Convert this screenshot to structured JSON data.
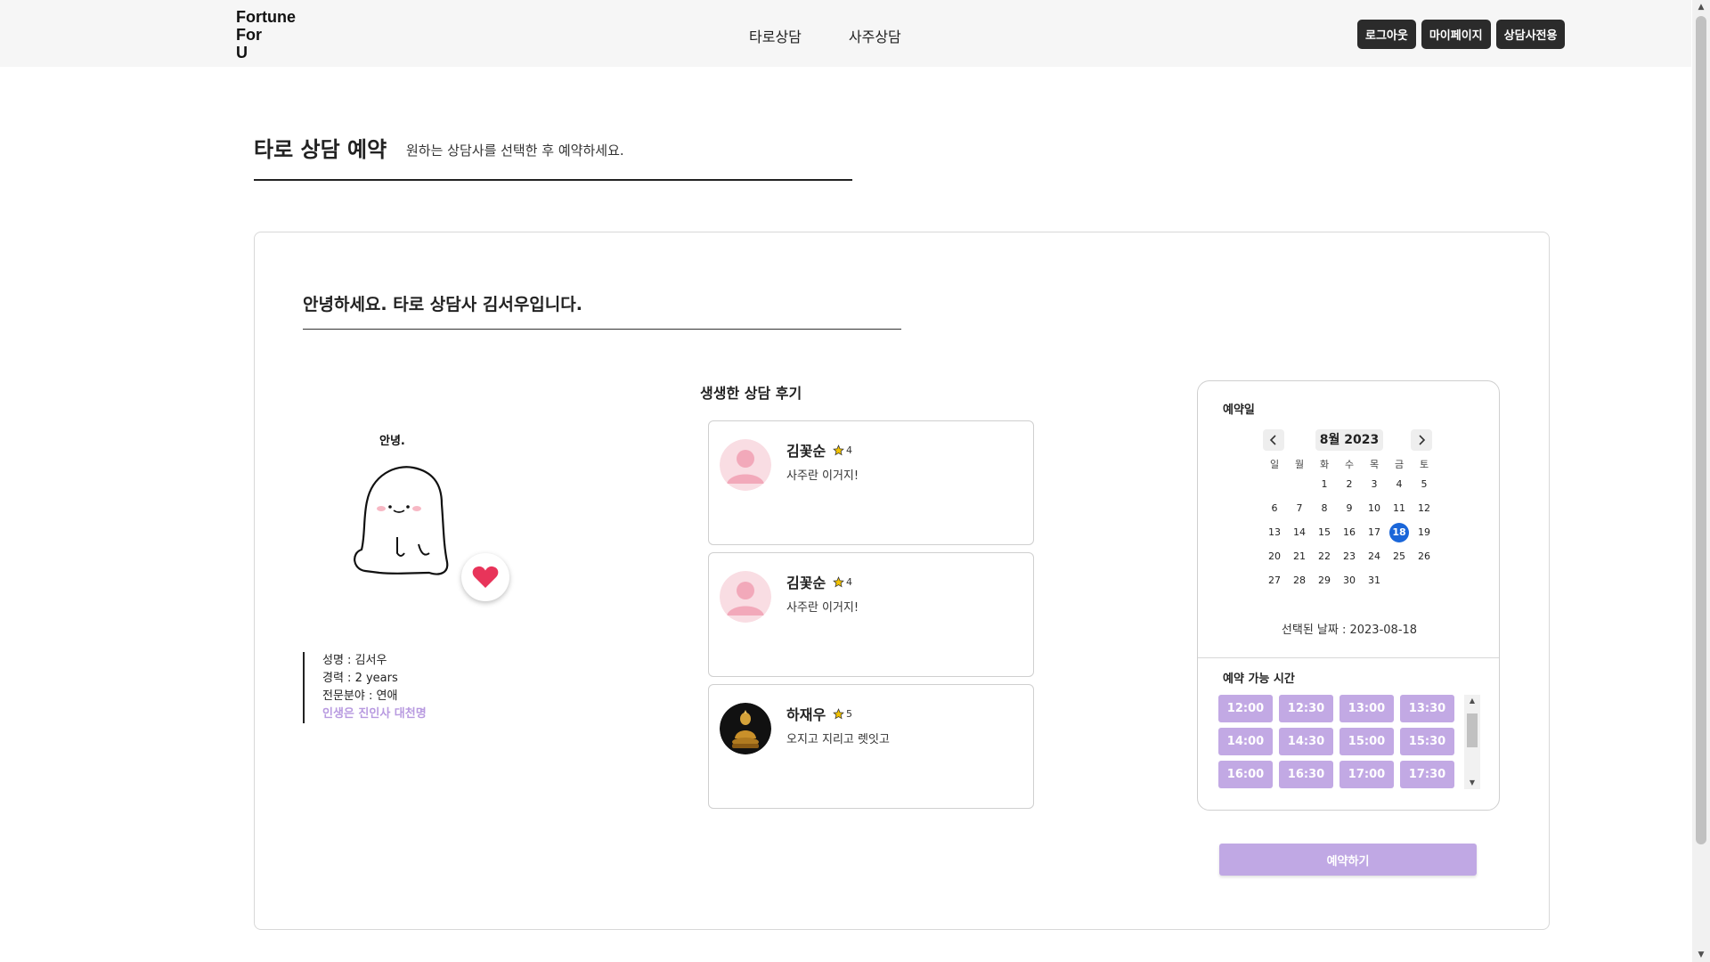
{
  "header": {
    "logo_lines": [
      "Fortune",
      "For",
      "U"
    ],
    "nav": [
      "타로상담",
      "사주상담"
    ],
    "auth": {
      "logout": "로그아웃",
      "mypage": "마이페이지",
      "counselor": "상담사전용"
    }
  },
  "page": {
    "title": "타로 상담 예약",
    "subtitle": "원하는 상담사를 선택한 후 예약하세요."
  },
  "consultant": {
    "greeting": "안녕하세요. 타로 상담사 김서우입니다.",
    "illustration_text": "안녕.",
    "name_line": "성명 : 김서우",
    "career_line": "경력 : 2 years",
    "field_line": "전문분야 : 연애",
    "motto": "인생은 진인사 대천명"
  },
  "reviews": {
    "title": "생생한 상담 후기",
    "items": [
      {
        "name": "김꽃순",
        "rating": "4",
        "text": "사주란 이거지!",
        "avatar": "default-avatar-icon"
      },
      {
        "name": "김꽃순",
        "rating": "4",
        "text": "사주란 이거지!",
        "avatar": "default-avatar-icon"
      },
      {
        "name": "하재우",
        "rating": "5",
        "text": "오지고 지리고 렛잇고",
        "avatar": "golden-buddha-photo"
      }
    ]
  },
  "booking": {
    "date_label": "예약일",
    "month_label": "8월 2023",
    "weekdays": [
      "일",
      "월",
      "화",
      "수",
      "목",
      "금",
      "토"
    ],
    "weeks": [
      [
        "",
        "",
        "1",
        "2",
        "3",
        "4",
        "5"
      ],
      [
        "6",
        "7",
        "8",
        "9",
        "10",
        "11",
        "12"
      ],
      [
        "13",
        "14",
        "15",
        "16",
        "17",
        "18",
        "19"
      ],
      [
        "20",
        "21",
        "22",
        "23",
        "24",
        "25",
        "26"
      ],
      [
        "27",
        "28",
        "29",
        "30",
        "31",
        "",
        ""
      ]
    ],
    "selected_day": "18",
    "selected_text": "선택된 날짜 : 2023-08-18",
    "time_label": "예약 가능 시간",
    "times": [
      "12:00",
      "12:30",
      "13:00",
      "13:30",
      "14:00",
      "14:30",
      "15:00",
      "15:30",
      "16:00",
      "16:30",
      "17:00",
      "17:30"
    ],
    "reserve_button": "예약하기"
  },
  "colors": {
    "accent_purple": "#c2a9e4",
    "motto_purple": "#b89ae0",
    "selected_blue": "#1a66d9",
    "header_bg": "#f6f6f6",
    "dark_button": "#2b2b2b",
    "heart_red": "#e8345a",
    "star_gold": "#f2c200"
  }
}
